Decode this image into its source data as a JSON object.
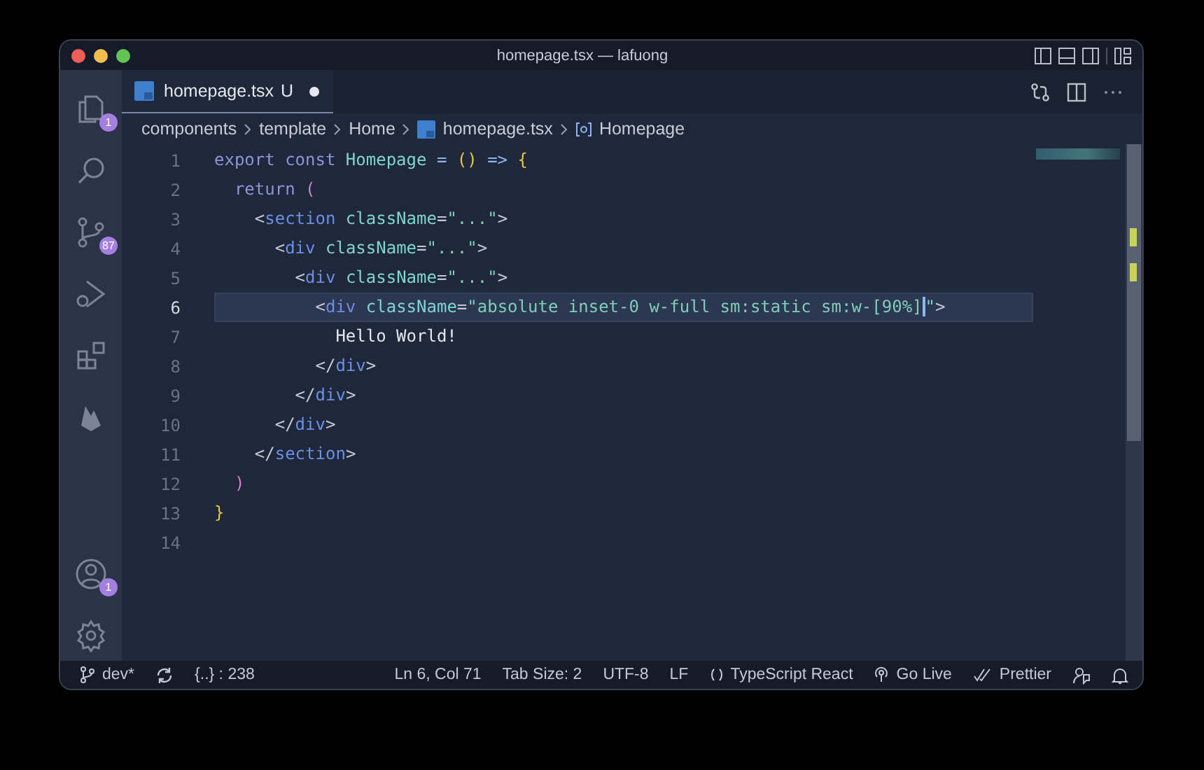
{
  "window": {
    "title": "homepage.tsx — lafuong"
  },
  "activity_bar": [
    {
      "kind": "files",
      "badge": "1"
    },
    {
      "kind": "search"
    },
    {
      "kind": "source-control",
      "badge": "87"
    },
    {
      "kind": "run-debug"
    },
    {
      "kind": "extensions"
    },
    {
      "kind": "flame"
    }
  ],
  "activity_bar_bottom": [
    {
      "kind": "account",
      "badge": "1"
    },
    {
      "kind": "settings"
    }
  ],
  "tabs": [
    {
      "label": "homepage.tsx",
      "status": "U",
      "dirty": true,
      "selected": true
    }
  ],
  "breadcrumbs": [
    {
      "label": "components",
      "kind": "folder"
    },
    {
      "label": "template",
      "kind": "folder"
    },
    {
      "label": "Home",
      "kind": "folder"
    },
    {
      "label": "homepage.tsx",
      "kind": "file"
    },
    {
      "label": "Homepage",
      "kind": "symbol"
    }
  ],
  "lines": [
    {
      "number": "1",
      "current": false,
      "tokens": [
        {
          "kind": "kw",
          "text": "export const "
        },
        {
          "kind": "name",
          "text": "Homepage"
        },
        {
          "kind": "op",
          "text": " = "
        },
        {
          "kind": "brace",
          "text": "()"
        },
        {
          "kind": "op",
          "text": " => "
        },
        {
          "kind": "brace",
          "text": "{"
        }
      ]
    },
    {
      "number": "2",
      "current": false,
      "tokens": [
        {
          "kind": "kw",
          "text": "  return "
        },
        {
          "kind": "paren",
          "text": "("
        }
      ]
    },
    {
      "number": "3",
      "current": false,
      "tokens": [
        {
          "kind": "punct",
          "text": "    <"
        },
        {
          "kind": "tag",
          "text": "section"
        },
        {
          "kind": "attr",
          "text": " className"
        },
        {
          "kind": "punct",
          "text": "="
        },
        {
          "kind": "str",
          "text": "\"...\""
        },
        {
          "kind": "punct",
          "text": ">"
        }
      ]
    },
    {
      "number": "4",
      "current": false,
      "tokens": [
        {
          "kind": "punct",
          "text": "      <"
        },
        {
          "kind": "tag",
          "text": "div"
        },
        {
          "kind": "attr",
          "text": " className"
        },
        {
          "kind": "punct",
          "text": "="
        },
        {
          "kind": "str",
          "text": "\"...\""
        },
        {
          "kind": "punct",
          "text": ">"
        }
      ]
    },
    {
      "number": "5",
      "current": false,
      "tokens": [
        {
          "kind": "punct",
          "text": "        <"
        },
        {
          "kind": "tag",
          "text": "div"
        },
        {
          "kind": "attr",
          "text": " className"
        },
        {
          "kind": "punct",
          "text": "="
        },
        {
          "kind": "str",
          "text": "\"...\""
        },
        {
          "kind": "punct",
          "text": ">"
        }
      ]
    },
    {
      "number": "6",
      "current": true,
      "tokens": [
        {
          "kind": "punct",
          "text": "          <"
        },
        {
          "kind": "tag",
          "text": "div"
        },
        {
          "kind": "attr",
          "text": " className"
        },
        {
          "kind": "punct",
          "text": "="
        },
        {
          "kind": "str",
          "text": "\"absolute inset-0 w-full sm:static sm:w-[90%]",
          "cursor": true
        },
        {
          "kind": "str",
          "text": "\""
        },
        {
          "kind": "punct",
          "text": ">"
        }
      ]
    },
    {
      "number": "7",
      "current": false,
      "tokens": [
        {
          "kind": "text",
          "text": "            Hello World!"
        }
      ]
    },
    {
      "number": "8",
      "current": false,
      "tokens": [
        {
          "kind": "punct",
          "text": "          </"
        },
        {
          "kind": "tag",
          "text": "div"
        },
        {
          "kind": "punct",
          "text": ">"
        }
      ]
    },
    {
      "number": "9",
      "current": false,
      "tokens": [
        {
          "kind": "punct",
          "text": "        </"
        },
        {
          "kind": "tag",
          "text": "div"
        },
        {
          "kind": "punct",
          "text": ">"
        }
      ]
    },
    {
      "number": "10",
      "current": false,
      "tokens": [
        {
          "kind": "punct",
          "text": "      </"
        },
        {
          "kind": "tag",
          "text": "div"
        },
        {
          "kind": "punct",
          "text": ">"
        }
      ]
    },
    {
      "number": "11",
      "current": false,
      "tokens": [
        {
          "kind": "punct",
          "text": "    </"
        },
        {
          "kind": "tag",
          "text": "section"
        },
        {
          "kind": "punct",
          "text": ">"
        }
      ]
    },
    {
      "number": "12",
      "current": false,
      "tokens": [
        {
          "kind": "paren",
          "text": "  )"
        }
      ]
    },
    {
      "number": "13",
      "current": false,
      "tokens": [
        {
          "kind": "brace",
          "text": "}"
        }
      ]
    },
    {
      "number": "14",
      "current": false
    }
  ],
  "status_bar": {
    "left": [
      {
        "kind": "branch",
        "text": "dev*"
      },
      {
        "kind": "sync"
      },
      {
        "kind": "plain",
        "text": "{..} : 238"
      }
    ],
    "right": [
      {
        "kind": "plain",
        "text": "Ln 6, Col 71"
      },
      {
        "kind": "plain",
        "text": "Tab Size: 2"
      },
      {
        "kind": "plain",
        "text": "UTF-8"
      },
      {
        "kind": "plain",
        "text": "LF"
      },
      {
        "kind": "language",
        "text": "TypeScript React"
      },
      {
        "kind": "live",
        "text": "Go Live"
      },
      {
        "kind": "prettier",
        "text": "Prettier"
      },
      {
        "kind": "feedback"
      },
      {
        "kind": "bell"
      }
    ]
  }
}
